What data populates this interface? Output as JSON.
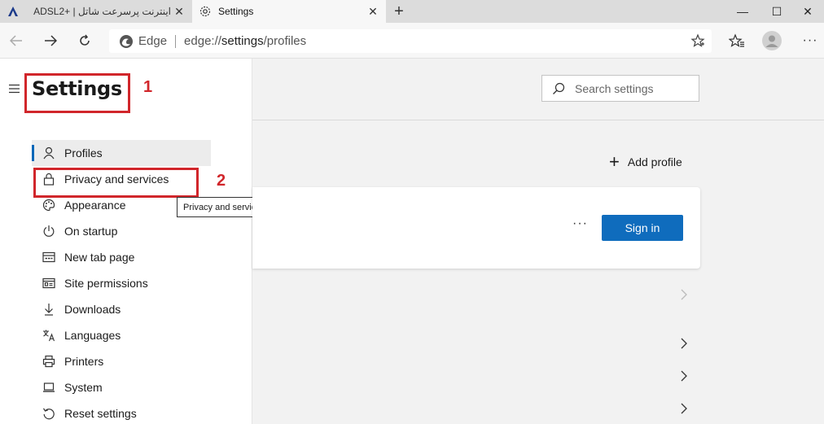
{
  "tabs": [
    {
      "title": "اینترنت پرسرعت شاتل | +ADSL2",
      "active": false
    },
    {
      "title": "Settings",
      "active": true
    }
  ],
  "omnibox": {
    "label": "Edge",
    "url_prefix": "edge://",
    "url_bold": "settings",
    "url_suffix": "/profiles"
  },
  "settings": {
    "title": "Settings",
    "search_placeholder": "Search settings",
    "nav_items": [
      {
        "label": "Profiles",
        "icon": "person-icon",
        "selected": true
      },
      {
        "label": "Privacy and services",
        "icon": "lock-icon"
      },
      {
        "label": "Appearance",
        "icon": "palette-icon"
      },
      {
        "label": "On startup",
        "icon": "power-icon"
      },
      {
        "label": "New tab page",
        "icon": "newtab-icon"
      },
      {
        "label": "Site permissions",
        "icon": "site-permissions-icon"
      },
      {
        "label": "Downloads",
        "icon": "download-icon"
      },
      {
        "label": "Languages",
        "icon": "languages-icon"
      },
      {
        "label": "Printers",
        "icon": "printer-icon"
      },
      {
        "label": "System",
        "icon": "laptop-icon"
      },
      {
        "label": "Reset settings",
        "icon": "reset-icon"
      }
    ],
    "tooltip": "Privacy and services",
    "add_profile": "Add profile",
    "more_label": "···",
    "signin_label": "Sign in"
  },
  "annotations": {
    "box1": "1",
    "box2": "2",
    "color": "#d1262b"
  },
  "colors": {
    "accent": "#0f6cbd",
    "selected_bar": "#0067b8"
  }
}
